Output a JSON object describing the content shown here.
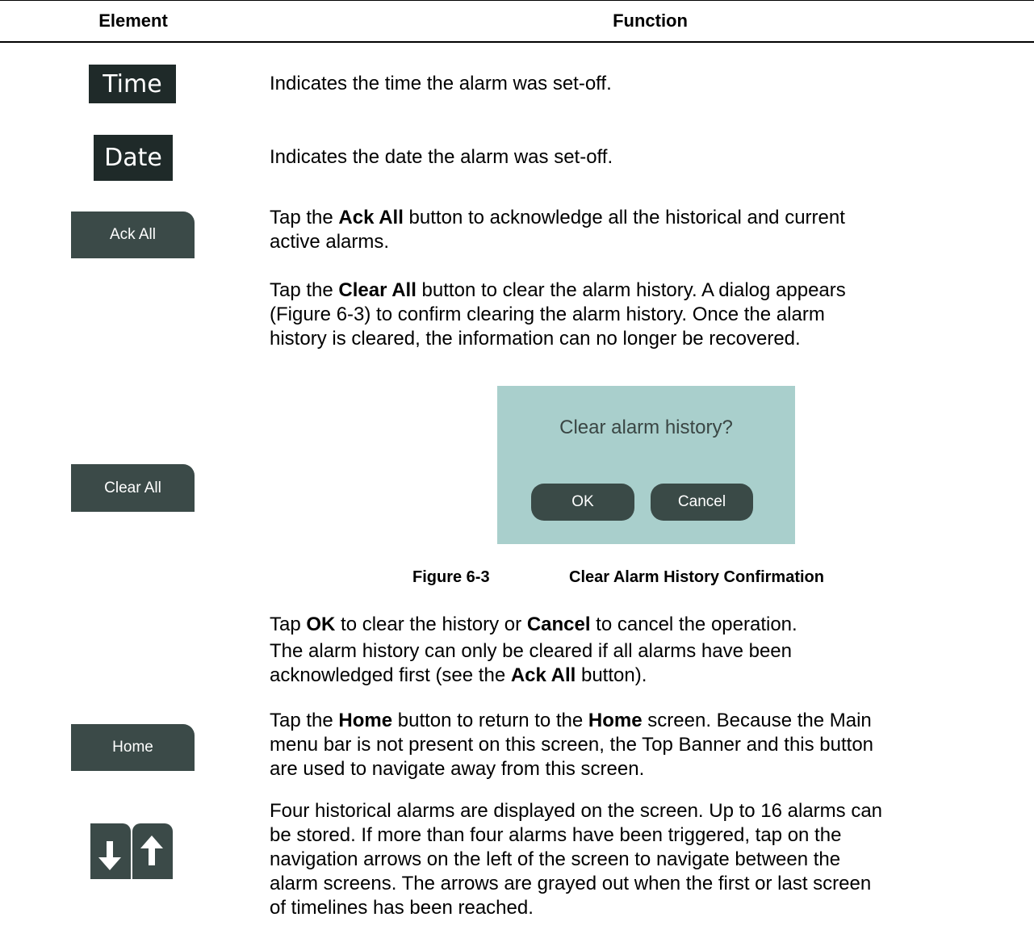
{
  "table": {
    "header": {
      "col_element": "Element",
      "col_function": "Function"
    },
    "rows": {
      "time": {
        "element_label": "Time",
        "text": "Indicates the time the alarm was set-off."
      },
      "date": {
        "element_label": "Date",
        "text": "Indicates the date the alarm was set-off."
      },
      "ack_all": {
        "element_label": "Ack All",
        "line1_a": "Tap the ",
        "line1_b": "Ack All",
        "line1_c": " button to acknowledge all the historical and current",
        "line2": "active alarms."
      },
      "clear_all": {
        "element_label": "Clear All",
        "p1_a": "Tap the ",
        "p1_b": "Clear All",
        "p1_c": " button to clear the alarm history. A dialog appears",
        "p2": "(Figure 6-3) to confirm clearing the alarm history. Once the alarm",
        "p3": "history is cleared, the information can no longer be recovered.",
        "dialog": {
          "question": "Clear alarm history?",
          "ok": "OK",
          "cancel": "Cancel"
        },
        "figure_number": "Figure 6-3",
        "figure_caption": "Clear Alarm History Confirmation",
        "tap_a": "Tap ",
        "tap_b": "OK",
        "tap_c": " to clear the history or ",
        "tap_d": "Cancel",
        "tap_e": " to cancel the operation.",
        "note1": "The alarm history can only be cleared if all alarms have been",
        "note2_a": "acknowledged first (see the ",
        "note2_b": "Ack All",
        "note2_c": " button)."
      },
      "home": {
        "element_label": "Home",
        "l1_a": "Tap the ",
        "l1_b": "Home",
        "l1_c": " button to return to the ",
        "l1_d": "Home",
        "l1_e": " screen. Because the Main",
        "l2": "menu bar is not present on this screen, the Top Banner and this button",
        "l3": "are used to navigate away from this screen."
      },
      "arrows": {
        "icons": [
          "arrow-down-icon",
          "arrow-up-icon"
        ],
        "l1": "Four historical alarms are displayed on the screen. Up to 16 alarms can",
        "l2": "be stored. If more than four alarms have been triggered, tap on the",
        "l3": "navigation arrows on the left of the screen to navigate between the",
        "l4": "alarm screens. The arrows are grayed out when the first or last screen",
        "l5": "of timelines has been reached."
      }
    }
  }
}
